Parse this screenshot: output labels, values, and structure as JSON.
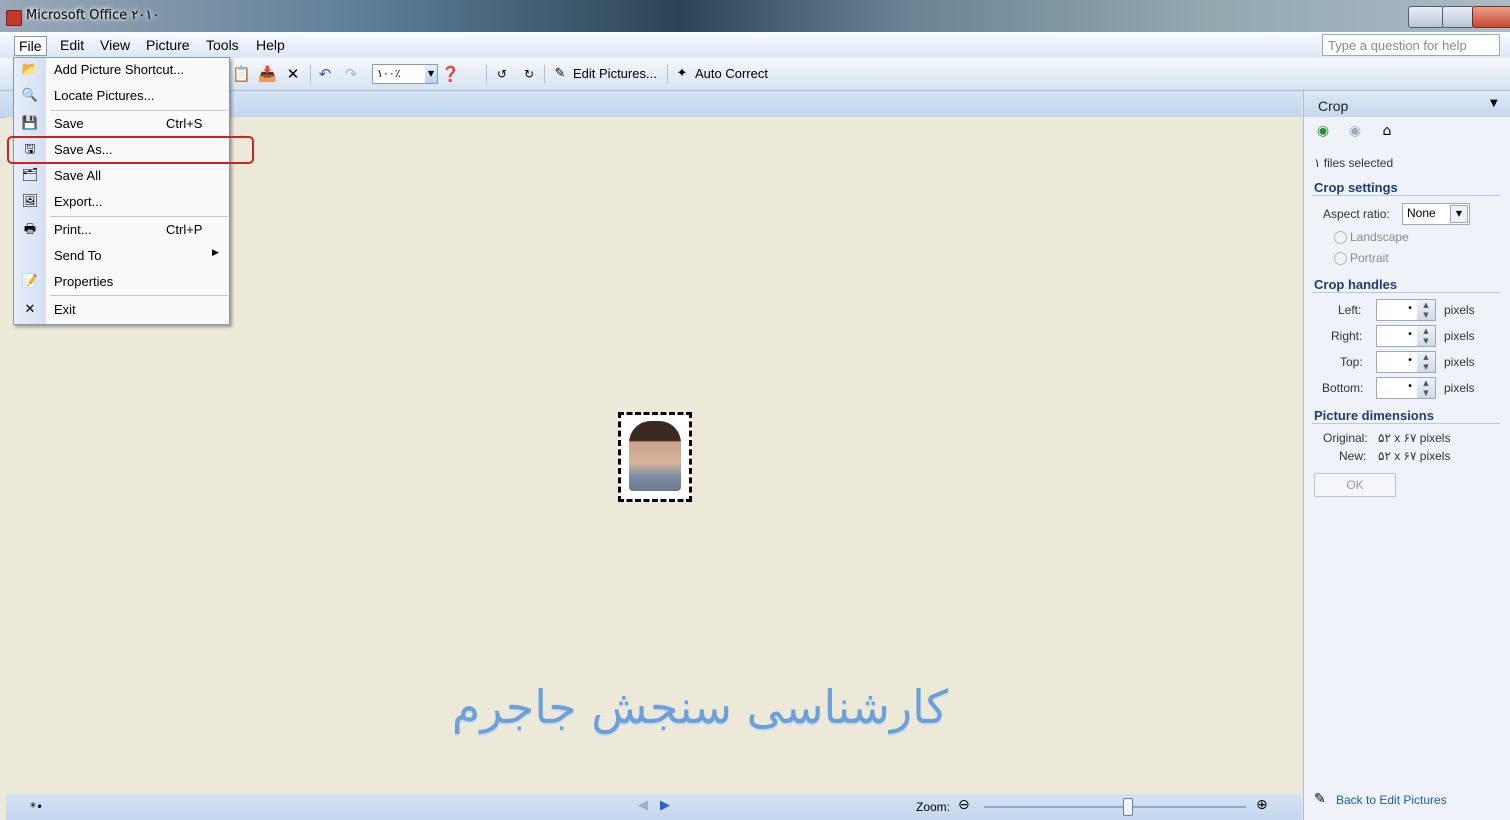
{
  "window": {
    "title": "Microsoft Office ۲۰۱۰"
  },
  "menubar": {
    "items": [
      "File",
      "Edit",
      "View",
      "Picture",
      "Tools",
      "Help"
    ]
  },
  "help_box": {
    "placeholder": "Type a question for help"
  },
  "toolbar": {
    "zoom_value": "۱۰۰٪",
    "edit_pictures": "Edit Pictures...",
    "auto_correct": "Auto Correct",
    "icons": [
      "open-icon",
      "paste-icon",
      "delete-icon",
      "undo-icon",
      "redo-icon",
      "help-icon",
      "rotate-left-icon",
      "rotate-right-icon",
      "edit-pictures-icon",
      "auto-correct-icon"
    ]
  },
  "file_menu": {
    "items": [
      {
        "label": "Add Picture Shortcut...",
        "shortcut": "",
        "icon": "add-shortcut-icon"
      },
      {
        "label": "Locate Pictures...",
        "shortcut": "",
        "icon": "locate-icon"
      },
      {
        "label": "Save",
        "shortcut": "Ctrl+S",
        "icon": "save-icon"
      },
      {
        "label": "Save As...",
        "shortcut": "",
        "icon": "save-as-icon"
      },
      {
        "label": "Save All",
        "shortcut": "",
        "icon": "save-all-icon"
      },
      {
        "label": "Export...",
        "shortcut": "",
        "icon": "export-icon"
      },
      {
        "label": "Print...",
        "shortcut": "Ctrl+P",
        "icon": "print-icon"
      },
      {
        "label": "Send To",
        "shortcut": "",
        "icon": "",
        "submenu": true
      },
      {
        "label": "Properties",
        "shortcut": "",
        "icon": "properties-icon"
      },
      {
        "label": "Exit",
        "shortcut": "",
        "icon": "exit-icon"
      }
    ],
    "highlighted": "Save As..."
  },
  "canvas": {
    "watermark": "کارشناسی سنجش جاجرم"
  },
  "statusbar": {
    "text": "*•",
    "zoom_label": "Zoom:",
    "zoom_level": 0.55
  },
  "task_pane": {
    "title": "Crop",
    "files_selected": "۱ files selected",
    "crop_settings": {
      "heading": "Crop settings",
      "aspect_label": "Aspect ratio:",
      "aspect_value": "None",
      "landscape": "Landscape",
      "portrait": "Portrait"
    },
    "crop_handles": {
      "heading": "Crop handles",
      "unit": "pixels",
      "rows": [
        {
          "label": "Left:",
          "value": "•"
        },
        {
          "label": "Right:",
          "value": "•"
        },
        {
          "label": "Top:",
          "value": "•"
        },
        {
          "label": "Bottom:",
          "value": "•"
        }
      ]
    },
    "dimensions": {
      "heading": "Picture dimensions",
      "original_label": "Original:",
      "original_value": "۵۲ x ۶۷ pixels",
      "new_label": "New:",
      "new_value": "۵۲ x ۶۷ pixels"
    },
    "ok": "OK",
    "back_link": "Back to Edit Pictures"
  }
}
